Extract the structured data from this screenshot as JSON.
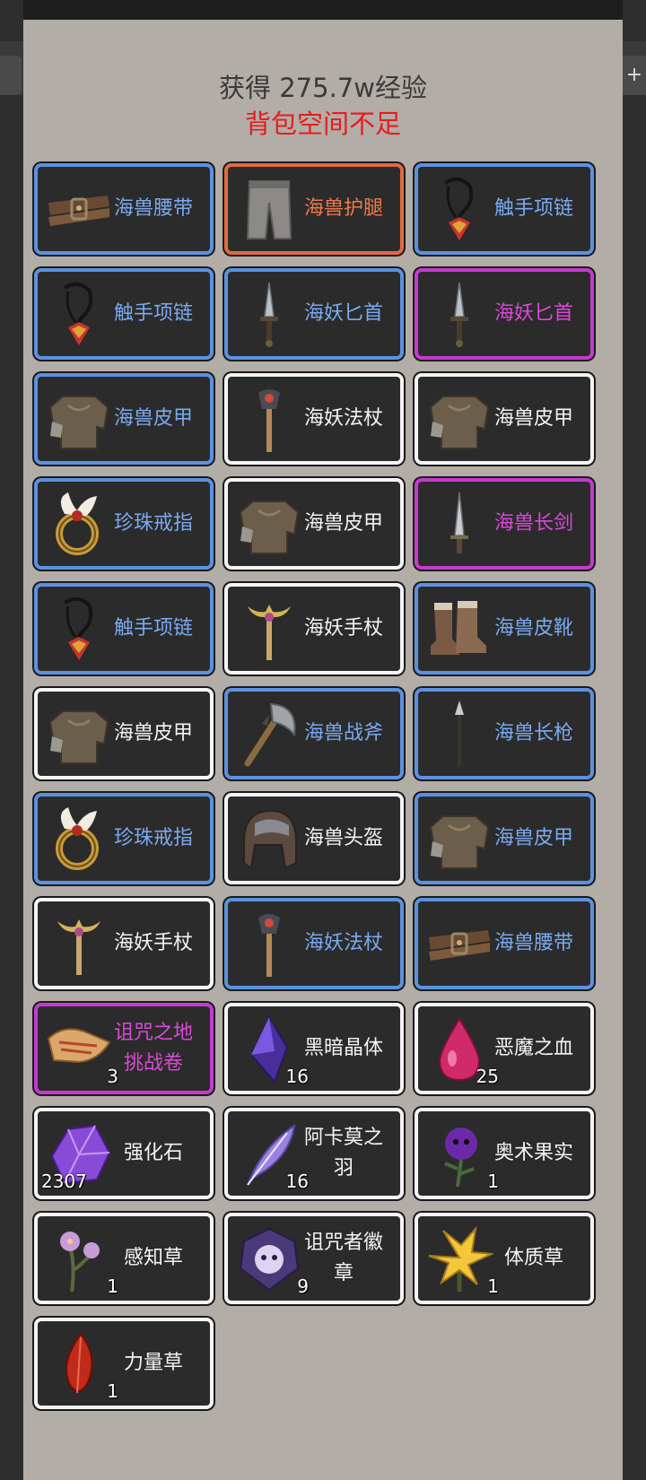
{
  "header": {
    "gain_text": "获得 275.7w经验",
    "warning_text": "背包空间不足"
  },
  "colors": {
    "blue": "#5b92e0",
    "white": "#f4f4f4",
    "orange": "#e26a3f",
    "purple": "#c53ad1",
    "warning": "#e51d1d",
    "panel": "#b3ada7"
  },
  "items": [
    {
      "name": "海兽腰带",
      "rarity": "blue",
      "icon": "belt-icon"
    },
    {
      "name": "海兽护腿",
      "rarity": "orange",
      "icon": "leggings-icon"
    },
    {
      "name": "触手项链",
      "rarity": "blue",
      "icon": "necklace-icon"
    },
    {
      "name": "触手项链",
      "rarity": "blue",
      "icon": "necklace-icon"
    },
    {
      "name": "海妖匕首",
      "rarity": "blue",
      "icon": "dagger-icon"
    },
    {
      "name": "海妖匕首",
      "rarity": "purple",
      "icon": "dagger-icon"
    },
    {
      "name": "海兽皮甲",
      "rarity": "blue",
      "icon": "armor-icon"
    },
    {
      "name": "海妖法杖",
      "rarity": "white",
      "icon": "staff-icon"
    },
    {
      "name": "海兽皮甲",
      "rarity": "white",
      "icon": "armor-icon"
    },
    {
      "name": "珍珠戒指",
      "rarity": "blue",
      "icon": "ring-icon"
    },
    {
      "name": "海兽皮甲",
      "rarity": "white",
      "icon": "armor-icon"
    },
    {
      "name": "海兽长剑",
      "rarity": "purple",
      "icon": "sword-icon"
    },
    {
      "name": "触手项链",
      "rarity": "blue",
      "icon": "necklace-icon"
    },
    {
      "name": "海妖手杖",
      "rarity": "white",
      "icon": "scepter-icon"
    },
    {
      "name": "海兽皮靴",
      "rarity": "blue",
      "icon": "boots-icon"
    },
    {
      "name": "海兽皮甲",
      "rarity": "white",
      "icon": "armor-icon"
    },
    {
      "name": "海兽战斧",
      "rarity": "blue",
      "icon": "axe-icon"
    },
    {
      "name": "海兽长枪",
      "rarity": "blue",
      "icon": "spear-icon"
    },
    {
      "name": "珍珠戒指",
      "rarity": "blue",
      "icon": "ring-icon"
    },
    {
      "name": "海兽头盔",
      "rarity": "white",
      "icon": "helmet-icon"
    },
    {
      "name": "海兽皮甲",
      "rarity": "blue",
      "icon": "armor-icon"
    },
    {
      "name": "海妖手杖",
      "rarity": "white",
      "icon": "scepter-icon"
    },
    {
      "name": "海妖法杖",
      "rarity": "blue",
      "icon": "staff-icon"
    },
    {
      "name": "海兽腰带",
      "rarity": "blue",
      "icon": "belt-icon"
    },
    {
      "name": "诅咒之地挑战卷",
      "rarity": "purple",
      "icon": "scroll-icon",
      "qty": "3"
    },
    {
      "name": "黑暗晶体",
      "rarity": "white",
      "icon": "dark-crystal-icon",
      "qty": "16"
    },
    {
      "name": "恶魔之血",
      "rarity": "white",
      "icon": "blood-drop-icon",
      "qty": "25"
    },
    {
      "name": "强化石",
      "rarity": "white",
      "icon": "enhance-stone-icon",
      "qty": "2307"
    },
    {
      "name": "阿卡莫之羽",
      "rarity": "white",
      "icon": "feather-icon",
      "qty": "16"
    },
    {
      "name": "奥术果实",
      "rarity": "white",
      "icon": "arcane-fruit-icon",
      "qty": "1"
    },
    {
      "name": "感知草",
      "rarity": "white",
      "icon": "perception-herb-icon",
      "qty": "1"
    },
    {
      "name": "诅咒者徽章",
      "rarity": "white",
      "icon": "badge-icon",
      "qty": "9"
    },
    {
      "name": "体质草",
      "rarity": "white",
      "icon": "constitution-herb-icon",
      "qty": "1"
    },
    {
      "name": "力量草",
      "rarity": "white",
      "icon": "strength-herb-icon",
      "qty": "1"
    }
  ]
}
